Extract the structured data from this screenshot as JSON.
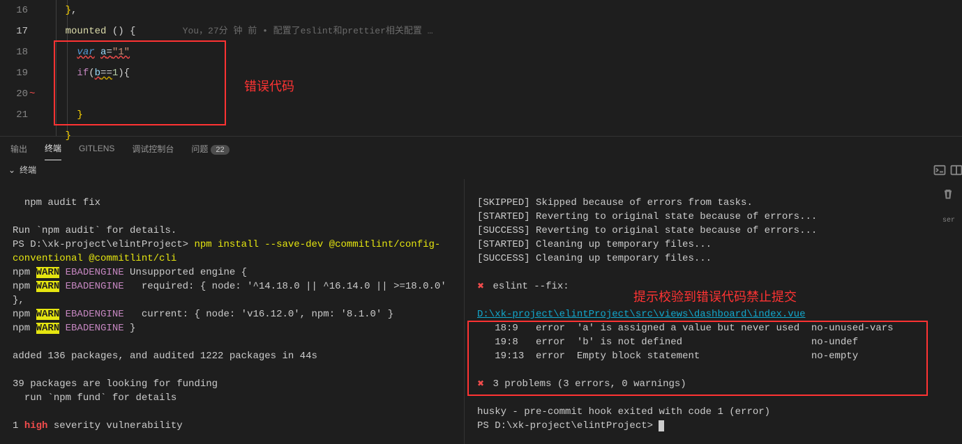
{
  "code": {
    "lines": [
      "16",
      "17",
      "18",
      "19",
      "20",
      "21"
    ],
    "l16": "},",
    "l17_func": "mounted",
    "l17_rest": " () {",
    "l18_kw": "var",
    "l18_var": "a",
    "l18_op": "=",
    "l18_str": "\"1\"",
    "l19_ctrl": "if",
    "l19_open": "(",
    "l19_var": "b",
    "l19_eq": "==",
    "l19_num": "1",
    "l19_close": "){",
    "l21_close": "}",
    "codelens": "You，27分 钟 前 • 配置了eslint和prettier相关配置 …"
  },
  "annotations": {
    "code_label": "错误代码",
    "terminal_label": "提示校验到错误代码禁止提交"
  },
  "tabs": {
    "output": "输出",
    "terminal": "终端",
    "gitlens": "GITLENS",
    "debug": "调试控制台",
    "problems": "问题",
    "problems_count": "22"
  },
  "terminal_header": "终端",
  "left_terminal": {
    "l1": "  npm audit fix",
    "l2": "",
    "l3": "Run `npm audit` for details.",
    "l4_a": "PS D:\\xk-project\\elintProject> ",
    "l4_b": "npm install --save-dev @commitlint/config-conventional @commitlint/cli",
    "l5_a": "npm ",
    "l5_b": "WARN",
    "l5_c": " EBADENGINE",
    "l5_d": " Unsupported engine {",
    "l6_a": "npm ",
    "l6_b": "WARN",
    "l6_c": " EBADENGINE",
    "l6_d": "   required: { node: '^14.18.0 || ^16.14.0 || >=18.0.0' },",
    "l7_a": "npm ",
    "l7_b": "WARN",
    "l7_c": " EBADENGINE",
    "l7_d": "   current: { node: 'v16.12.0', npm: '8.1.0' }",
    "l8_a": "npm ",
    "l8_b": "WARN",
    "l8_c": " EBADENGINE",
    "l8_d": " }",
    "l9": "",
    "l10": "added 136 packages, and audited 1222 packages in 44s",
    "l11": "",
    "l12": "39 packages are looking for funding",
    "l13": "  run `npm fund` for details",
    "l14": "",
    "l15_a": "1 ",
    "l15_b": "high",
    "l15_c": " severity vulnerability"
  },
  "right_terminal": {
    "r1": "[SKIPPED] Skipped because of errors from tasks.",
    "r2": "[STARTED] Reverting to original state because of errors...",
    "r3": "[SUCCESS] Reverting to original state because of errors...",
    "r4": "[STARTED] Cleaning up temporary files...",
    "r5": "[SUCCESS] Cleaning up temporary files...",
    "r6": "",
    "r7": " eslint --fix:",
    "r8": "",
    "r9": "D:\\xk-project\\elintProject\\src\\views\\dashboard\\index.vue",
    "r10": "   18:9   error  'a' is assigned a value but never used  no-unused-vars",
    "r11": "   19:8   error  'b' is not defined                      no-undef",
    "r12": "   19:13  error  Empty block statement                   no-empty",
    "r13": "",
    "r14": " 3 problems (3 errors, 0 warnings)",
    "r15": "",
    "r16": "husky - pre-commit hook exited with code 1 (error)",
    "r17": "PS D:\\xk-project\\elintProject> "
  },
  "right_label": "ser"
}
